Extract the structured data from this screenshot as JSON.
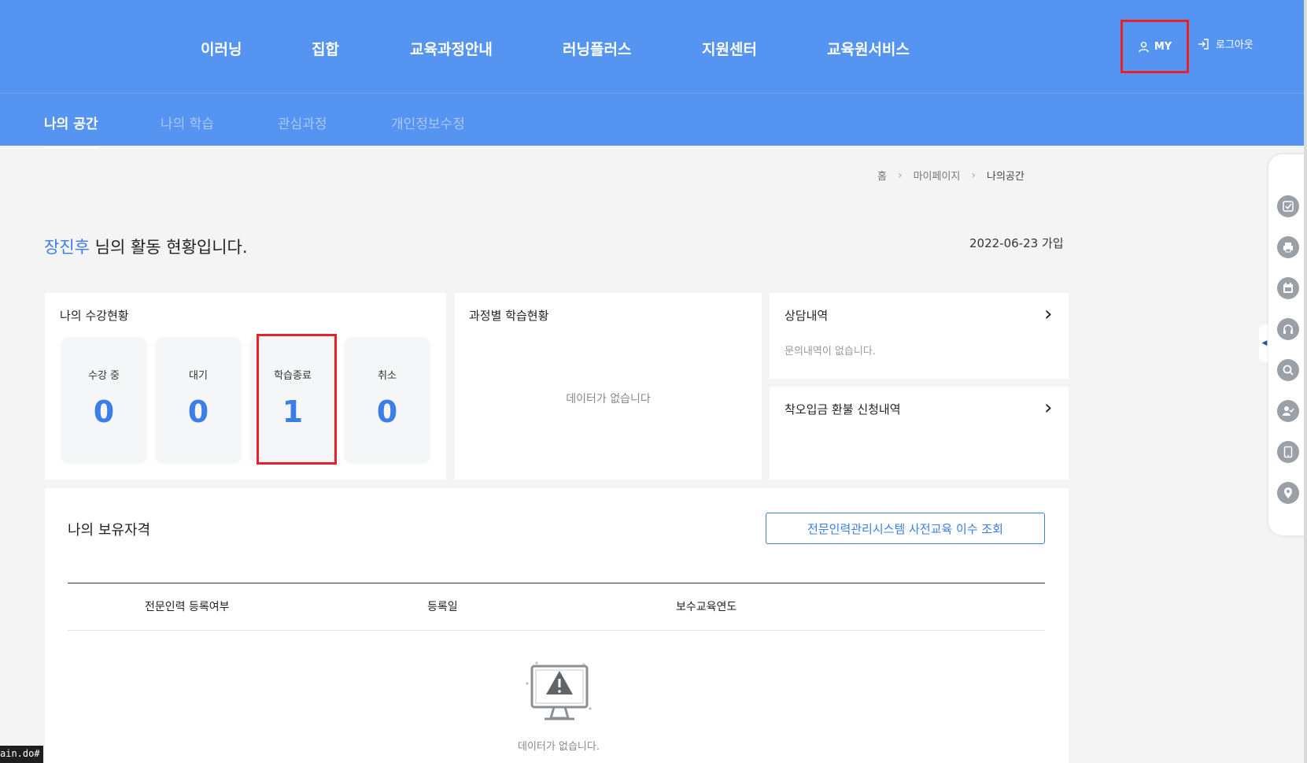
{
  "gnb": {
    "items": [
      "이러닝",
      "집합",
      "교육과정안내",
      "러닝플러스",
      "지원센터",
      "교육원서비스"
    ],
    "my_label": "MY",
    "logout_label": "로그아웃"
  },
  "subnav": {
    "tabs": [
      "나의 공간",
      "나의 학습",
      "관심과정",
      "개인정보수정"
    ]
  },
  "breadcrumb": [
    "홈",
    "마이페이지",
    "나의공간"
  ],
  "greeting": {
    "name": "장진후",
    "suffix": " 님의 활동 현황입니다.",
    "joined": "2022-06-23 가입"
  },
  "enrollment": {
    "title": "나의 수강현황",
    "stats": [
      {
        "label": "수강 중",
        "value": "0"
      },
      {
        "label": "대기",
        "value": "0"
      },
      {
        "label": "학습종료",
        "value": "1"
      },
      {
        "label": "취소",
        "value": "0"
      }
    ]
  },
  "course_progress": {
    "title": "과정별 학습현황",
    "empty": "데이터가 없습니다"
  },
  "consultation": {
    "title": "상담내역",
    "empty": "문의내역이 없습니다."
  },
  "refund": {
    "title": "착오입금 환불 신청내역"
  },
  "qualifications": {
    "title": "나의 보유자격",
    "button": "전문인력관리시스템 사전교육 이수 조회",
    "columns": [
      "전문인력 등록여부",
      "등록일",
      "보수교육연도"
    ],
    "empty": "데이터가 없습니다."
  },
  "quick_menu": {
    "icons": [
      "check-icon",
      "print-icon",
      "calendar-icon",
      "headset-icon",
      "search-icon",
      "user-check-icon",
      "tablet-icon",
      "location-icon"
    ],
    "icon_color": "#9aa0a6"
  },
  "status_bar": {
    "url": "ain.do#"
  },
  "colors": {
    "header_bg": "#5594f0",
    "accent": "#3a7ee6",
    "highlight": "#e8202a"
  }
}
